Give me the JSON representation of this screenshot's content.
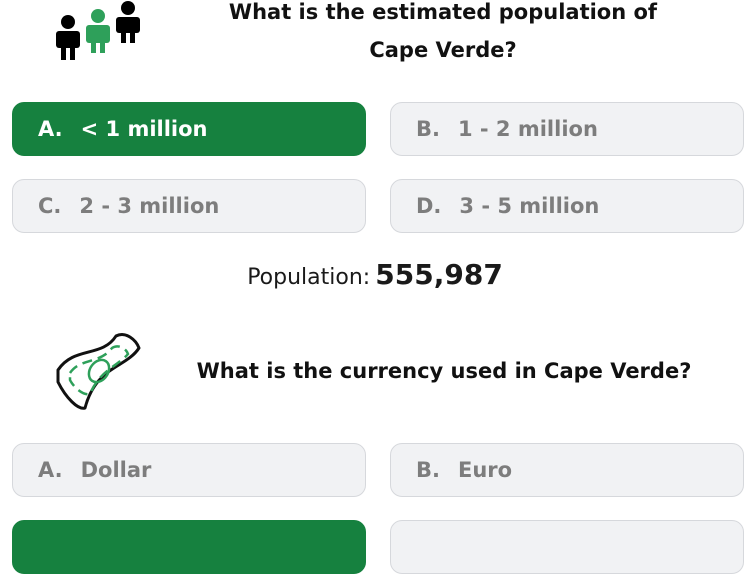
{
  "question1": {
    "icon": "people-icon",
    "text": "What is the estimated population of Cape Verde?",
    "options": [
      {
        "letter": "A.",
        "label": "< 1 million",
        "selected": true
      },
      {
        "letter": "B.",
        "label": "1 - 2 million",
        "selected": false
      },
      {
        "letter": "C.",
        "label": "2 - 3 million",
        "selected": false
      },
      {
        "letter": "D.",
        "label": "3 - 5 million",
        "selected": false
      }
    ],
    "answer_label": "Population:",
    "answer_value": "555,987"
  },
  "question2": {
    "icon": "banknote-icon",
    "text": "What is the currency used in Cape Verde?",
    "options": [
      {
        "letter": "A.",
        "label": "Dollar",
        "selected": false
      },
      {
        "letter": "B.",
        "label": "Euro",
        "selected": false
      },
      {
        "letter": "",
        "label": "",
        "selected": true
      },
      {
        "letter": "",
        "label": "",
        "selected": false
      }
    ]
  },
  "colors": {
    "selected": "#16813f",
    "option_bg": "#f1f2f4",
    "option_text": "#7d7d7d"
  }
}
